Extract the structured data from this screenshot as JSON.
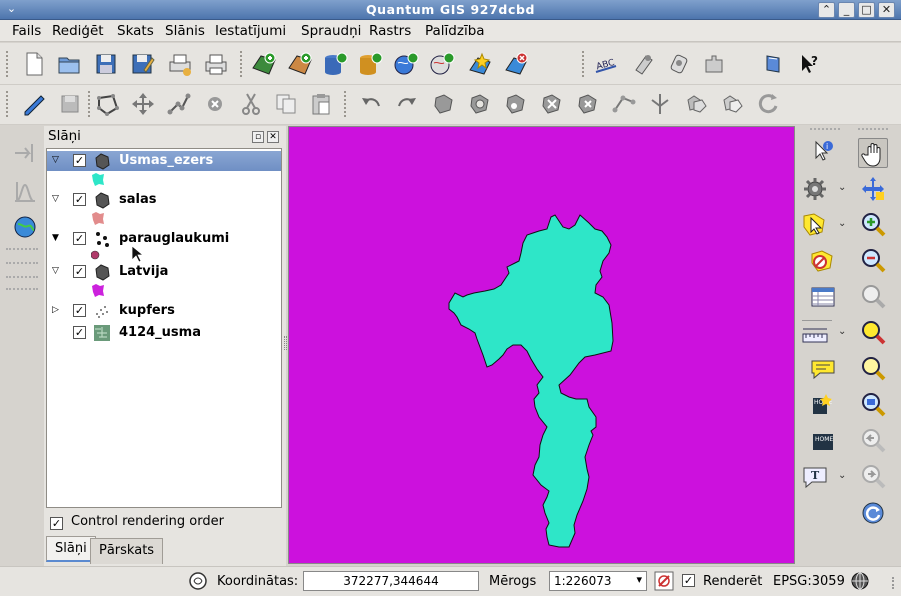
{
  "window": {
    "title": "Quantum GIS 927dcbd"
  },
  "menu": [
    "Fails",
    "Rediģēt",
    "Skats",
    "Slānis",
    "Iestatījumi",
    "Spraudņi",
    "Rastrs",
    "Palīdzība"
  ],
  "toolbar1": [
    "new-project-icon",
    "open-project-icon",
    "save-project-icon",
    "save-as-icon",
    "print-composer-icon",
    "print-icon",
    "add-vector-layer-icon",
    "add-raster-layer-icon",
    "add-postgis-layer-icon",
    "add-spatialite-layer-icon",
    "add-wms-layer-icon",
    "add-wfs-layer-icon",
    "new-vector-layer-icon",
    "remove-layer-icon",
    "label-icon",
    "georeferencer-icon",
    "gps-icon",
    "plugin-icon",
    "help-book-icon",
    "whats-this-icon"
  ],
  "toolbar2": [
    "toggle-edit-icon",
    "save-edits-icon",
    "capture-polygon-icon",
    "move-feature-icon",
    "node-tool-icon",
    "delete-selected-icon",
    "cut-icon",
    "copy-icon",
    "paste-icon",
    "undo-icon",
    "redo-icon",
    "simplify-icon",
    "add-ring-icon",
    "add-island-icon",
    "delete-ring-icon",
    "delete-part-icon",
    "reshape-icon",
    "split-features-icon",
    "merge-features-icon",
    "merge-attributes-icon",
    "rotate-point-symbols-icon"
  ],
  "panel": {
    "title": "Slāņi",
    "layers": [
      {
        "name": "Usmas_ezers",
        "checked": true,
        "expanded": true,
        "selected": true,
        "type": "polygon",
        "color": "#2ee6c8"
      },
      {
        "name": "salas",
        "checked": true,
        "expanded": true,
        "selected": false,
        "type": "polygon",
        "color": "#e28c8c"
      },
      {
        "name": "parauglaukumi",
        "checked": true,
        "expanded": true,
        "selected": false,
        "type": "point",
        "color": "#b03a6a"
      },
      {
        "name": "Latvija",
        "checked": true,
        "expanded": true,
        "selected": false,
        "type": "polygon",
        "color": "#cc22dd"
      },
      {
        "name": "kupfers",
        "checked": true,
        "expanded": false,
        "selected": false,
        "type": "raster-points"
      },
      {
        "name": "4124_usma",
        "checked": true,
        "expanded": false,
        "selected": false,
        "type": "raster"
      }
    ],
    "control_rendering_order": "Control rendering order",
    "tabs": [
      "Slāņi",
      "Pārskats"
    ]
  },
  "map": {
    "background": "#cc11dd",
    "lake_color": "#2ee6c8"
  },
  "status": {
    "coords_label": "Koordinātas:",
    "coords_value": "372277,344644",
    "scale_label": "Mērogs",
    "scale_value": "1:226073",
    "render_label": "Renderēt",
    "epsg": "EPSG:3059"
  }
}
